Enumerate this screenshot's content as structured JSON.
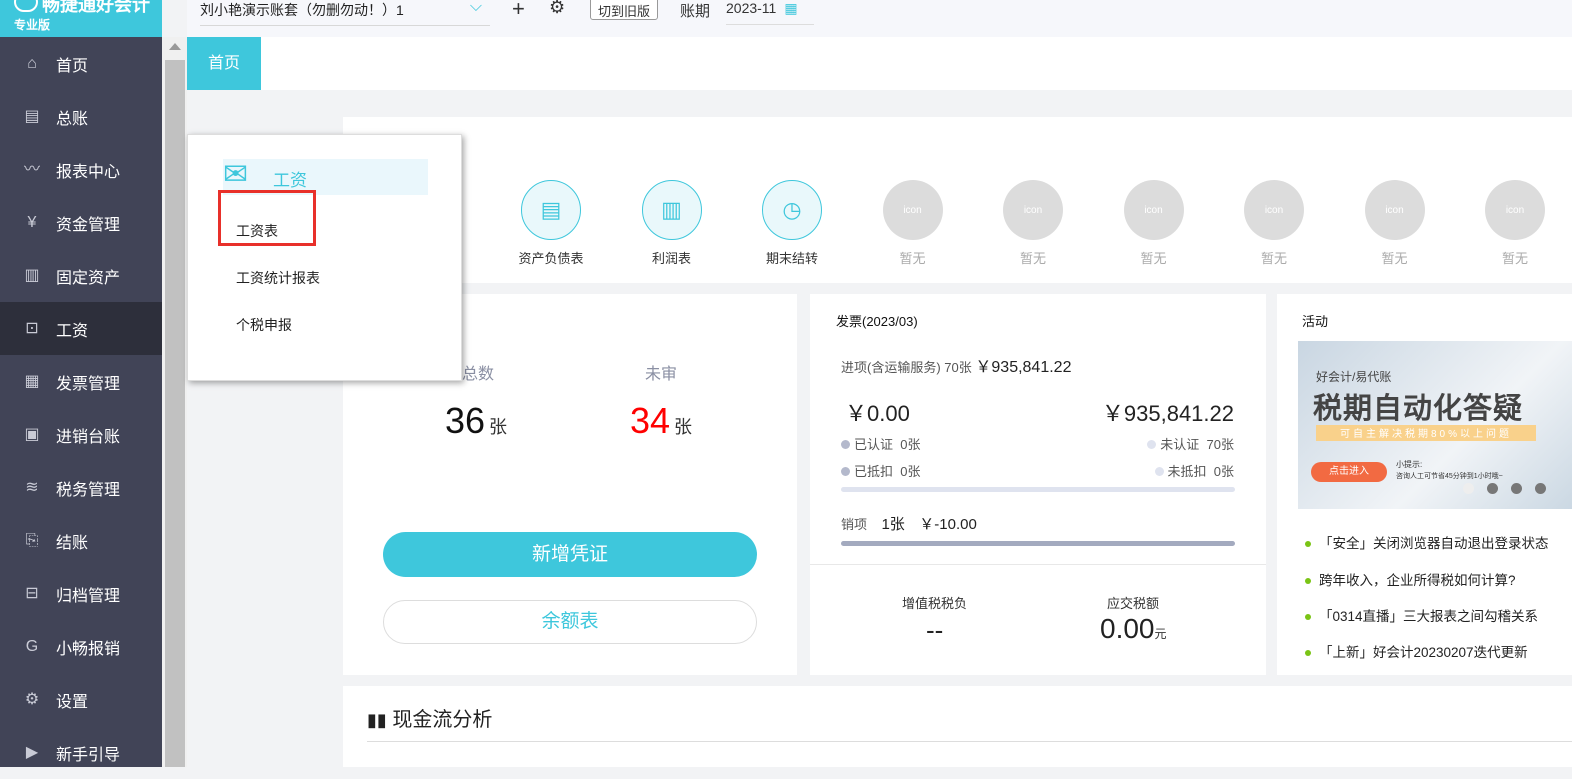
{
  "app": {
    "name": "畅捷通好会计",
    "edition": "专业版"
  },
  "sidebar": {
    "items": [
      {
        "label": "首页",
        "icon": "home-icon",
        "glyph": "⌂"
      },
      {
        "label": "总账",
        "icon": "ledger-icon",
        "glyph": "▤"
      },
      {
        "label": "报表中心",
        "icon": "chart-icon",
        "glyph": "〰"
      },
      {
        "label": "资金管理",
        "icon": "money-bag-icon",
        "glyph": "¥"
      },
      {
        "label": "固定资产",
        "icon": "asset-icon",
        "glyph": "▥"
      },
      {
        "label": "工资",
        "icon": "salary-icon",
        "glyph": "⊡"
      },
      {
        "label": "发票管理",
        "icon": "invoice-icon",
        "glyph": "▦"
      },
      {
        "label": "进销台账",
        "icon": "inventory-icon",
        "glyph": "▣"
      },
      {
        "label": "税务管理",
        "icon": "tax-icon",
        "glyph": "≋"
      },
      {
        "label": "结账",
        "icon": "checkout-icon",
        "glyph": "⎘"
      },
      {
        "label": "归档管理",
        "icon": "archive-icon",
        "glyph": "⊟"
      },
      {
        "label": "小畅报销",
        "icon": "reimburse-icon",
        "glyph": "G"
      },
      {
        "label": "设置",
        "icon": "gear-icon",
        "glyph": "⚙"
      },
      {
        "label": "新手引导",
        "icon": "play-icon",
        "glyph": "▶"
      }
    ],
    "active": "工资"
  },
  "header": {
    "account": "刘小艳演示账套（勿删勿动！）1",
    "switch_old": "切到旧版",
    "period_label": "账期",
    "period": "2023-11"
  },
  "tabs": [
    {
      "label": "首页"
    }
  ],
  "quick": [
    {
      "label": "资产负债表",
      "glyph": "▤"
    },
    {
      "label": "利润表",
      "glyph": "▥"
    },
    {
      "label": "期末结转",
      "glyph": "◷"
    },
    {
      "label": "暂无",
      "glyph": "icon"
    },
    {
      "label": "暂无",
      "glyph": "icon"
    },
    {
      "label": "暂无",
      "glyph": "icon"
    },
    {
      "label": "暂无",
      "glyph": "icon"
    },
    {
      "label": "暂无",
      "glyph": "icon"
    },
    {
      "label": "暂无",
      "glyph": "icon"
    }
  ],
  "voucher": {
    "total_label": "总数",
    "total": "36",
    "unreviewed_label": "未审",
    "unreviewed": "34",
    "unit": "张",
    "new_btn": "新增凭证",
    "balance_btn": "余额表"
  },
  "invoice": {
    "title": "发票(2023/03)",
    "in_label": "进项(含运输服务)",
    "in_count": "70张",
    "in_amount": "￥935,841.22",
    "left_amount": "￥0.00",
    "right_amount": "￥935,841.22",
    "certified": "已认证",
    "certified_n": "0张",
    "uncertified": "未认证",
    "uncertified_n": "70张",
    "deducted": "已抵扣",
    "deducted_n": "0张",
    "undeducted": "未抵扣",
    "undeducted_n": "0张",
    "out_label": "销项",
    "out_count": "1张",
    "out_amount": "￥-10.00",
    "vat_label": "增值税税负",
    "vat": "--",
    "tax_label": "应交税额",
    "tax": "0.00",
    "tax_unit": "元"
  },
  "activity": {
    "title": "活动",
    "banner": {
      "brand": "好会计/易代账",
      "headline": "税期自动化答疑",
      "sub": "可自主解决税期80%以上问题",
      "cta": "点击进入",
      "tip": "小提示:",
      "tip2": "咨询人工可节省45分钟到1小时哦~"
    },
    "news": [
      "「安全」关闭浏览器自动退出登录状态",
      "跨年收入，企业所得税如何计算?",
      "「0314直播」三大报表之间勾稽关系",
      "「上新」好会计20230207迭代更新"
    ]
  },
  "cashflow": {
    "title": "现金流分析"
  },
  "popup": {
    "title": "工资",
    "items": [
      "工资表",
      "工资统计报表",
      "个税申报"
    ]
  },
  "colors": {
    "accent": "#3ec7dc",
    "sidebar": "#414457",
    "red": "#ff0000",
    "highlight_box": "#e8302a"
  }
}
